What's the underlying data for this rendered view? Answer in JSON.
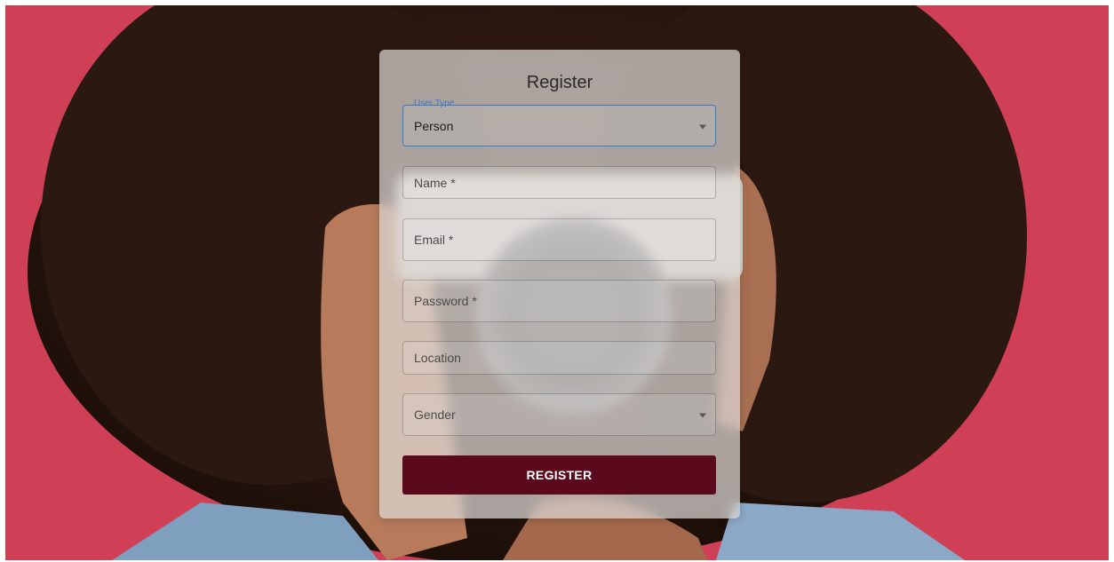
{
  "form": {
    "title": "Register",
    "user_type": {
      "label": "User Type",
      "value": "Person"
    },
    "name": {
      "placeholder": "Name *"
    },
    "email": {
      "placeholder": "Email *"
    },
    "password": {
      "placeholder": "Password *"
    },
    "location": {
      "placeholder": "Location"
    },
    "gender": {
      "placeholder": "Gender"
    },
    "submit_label": "REGISTER"
  },
  "colors": {
    "background_red": "#cf3f56",
    "button": "#5b0a1e",
    "focus_blue": "#3a78c9"
  },
  "icons": {
    "user_type_caret": "chevron-down-icon",
    "gender_caret": "chevron-down-icon"
  }
}
